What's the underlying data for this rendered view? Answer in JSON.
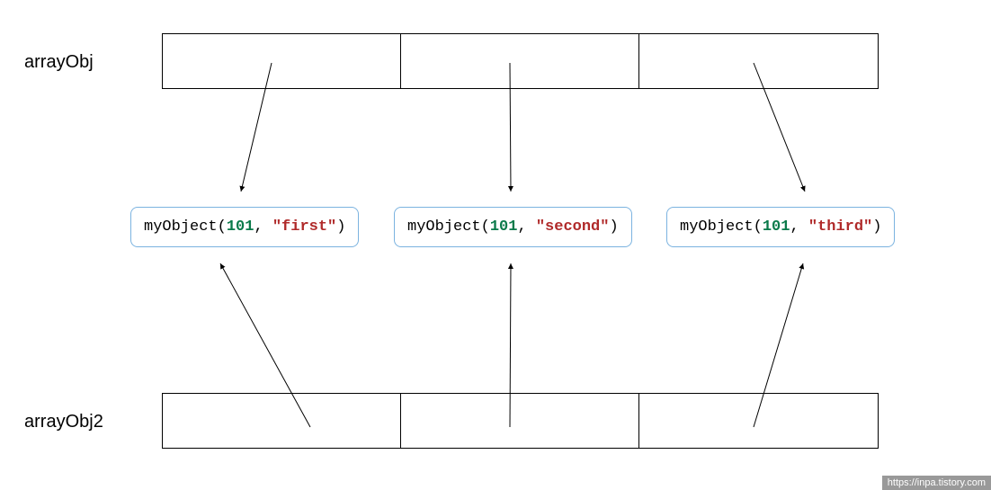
{
  "labels": {
    "top": "arrayObj",
    "bottom": "arrayObj2"
  },
  "objects": {
    "functionName": "myObject",
    "items": [
      {
        "num": "101",
        "str": "\"first\""
      },
      {
        "num": "101",
        "str": "\"second\""
      },
      {
        "num": "101",
        "str": "\"third\""
      }
    ]
  },
  "watermark": "https://inpa.tistory.com",
  "colors": {
    "boxBorder": "#7bb3e0",
    "number": "#0a7a4a",
    "string": "#b02a2a"
  }
}
